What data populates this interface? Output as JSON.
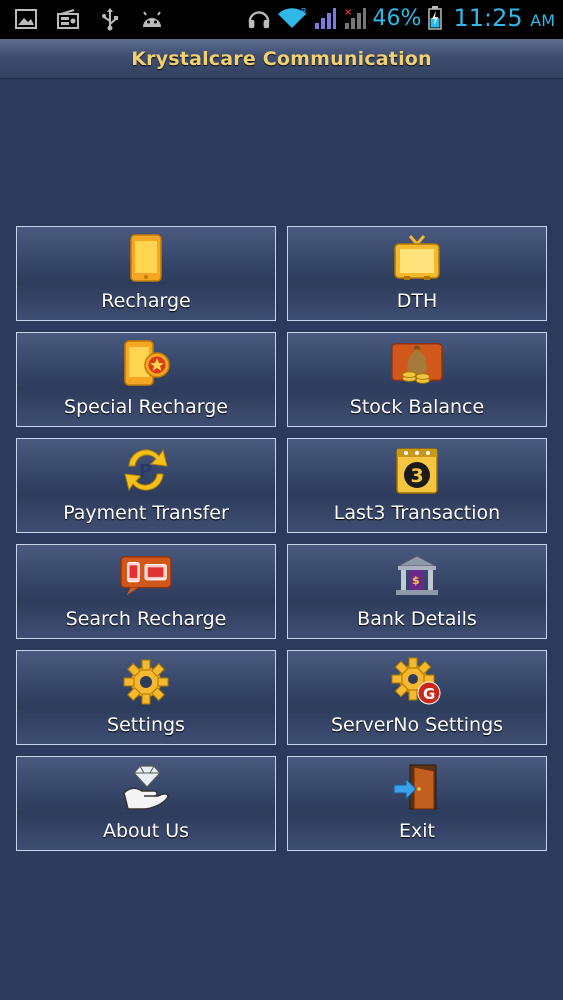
{
  "status_bar": {
    "battery_percent": "46%",
    "time": "11:25",
    "ampm": "AM",
    "left_icons": [
      "image-icon",
      "radio-icon",
      "usb-icon",
      "android-icon"
    ],
    "right_icons": [
      "headphones-icon",
      "wifi-icon",
      "signal-icon",
      "signal-no-sim-icon",
      "battery-icon"
    ]
  },
  "app": {
    "title": "Krystalcare Communication"
  },
  "menu": {
    "items": [
      {
        "label": "Recharge",
        "icon": "phone-icon"
      },
      {
        "label": "DTH",
        "icon": "tv-icon"
      },
      {
        "label": "Special Recharge",
        "icon": "phone-star-icon"
      },
      {
        "label": "Stock Balance",
        "icon": "money-bag-icon"
      },
      {
        "label": "Payment Transfer",
        "icon": "payment-transfer-icon"
      },
      {
        "label": "Last3 Transaction",
        "icon": "calendar-three-icon"
      },
      {
        "label": "Search Recharge",
        "icon": "search-recharge-icon"
      },
      {
        "label": "Bank Details",
        "icon": "bank-icon"
      },
      {
        "label": "Settings",
        "icon": "gear-icon"
      },
      {
        "label": "ServerNo Settings",
        "icon": "gear-g-icon"
      },
      {
        "label": "About Us",
        "icon": "diamond-hand-icon"
      },
      {
        "label": "Exit",
        "icon": "exit-door-icon"
      }
    ]
  },
  "colors": {
    "background": "#2c3a5e",
    "title_text": "#f0d070",
    "status_text": "#2fb8e8",
    "tile_border": "#c8d2ea"
  }
}
